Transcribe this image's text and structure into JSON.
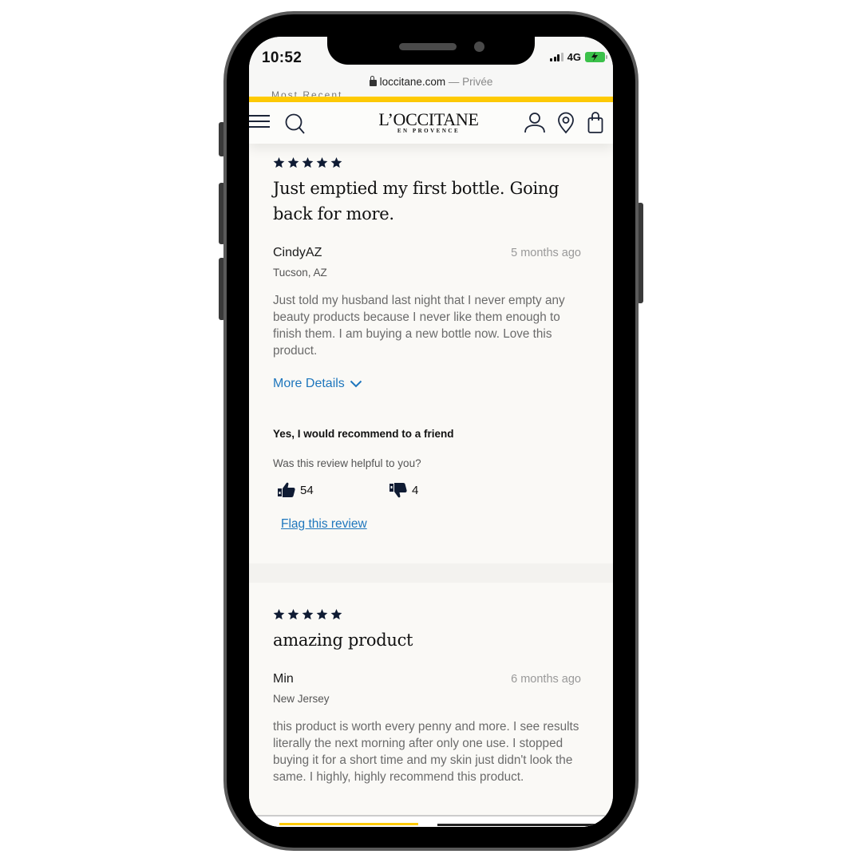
{
  "status_bar": {
    "time": "10:52",
    "network": "4G",
    "signal_bars_filled": 3,
    "signal_bars_total": 4,
    "battery_state": "charging"
  },
  "browser": {
    "url": "loccitane.com",
    "separator": " — ",
    "mode": "Privée",
    "peek_text": "Most Recent"
  },
  "header": {
    "logo_main": "L’OCCITANE",
    "logo_sub": "EN PROVENCE",
    "icons": [
      "menu-icon",
      "search-icon",
      "account-icon",
      "store-locator-icon",
      "shopping-bag-icon"
    ]
  },
  "colors": {
    "accent_yellow": "#ffcb05",
    "link_blue": "#1e76bd",
    "star_navy": "#0f1b33"
  },
  "reviews": [
    {
      "rating": 5,
      "max_rating": 5,
      "title": "Just emptied my first bottle. Going back for more.",
      "author": "CindyAZ",
      "date": "5 months ago",
      "location": "Tucson, AZ",
      "body": "Just told my husband last night that I never empty any beauty products because I never like them enough to finish them. I am buying a new bottle now. Love this product.",
      "more_details_label": "More Details",
      "recommend_text": "Yes, I would recommend to a friend",
      "helpful_question": "Was this review helpful to you?",
      "helpful_yes": "54",
      "helpful_no": "4",
      "flag_label": "Flag this review"
    },
    {
      "rating": 5,
      "max_rating": 5,
      "title": "amazing product",
      "author": "Min",
      "date": "6 months ago",
      "location": "New Jersey",
      "body": "this product is worth every penny and more. I see results literally the next morning after only one use. I stopped buying it for a short time and my skin just didn't look the same. I highly, highly recommend this product."
    }
  ]
}
